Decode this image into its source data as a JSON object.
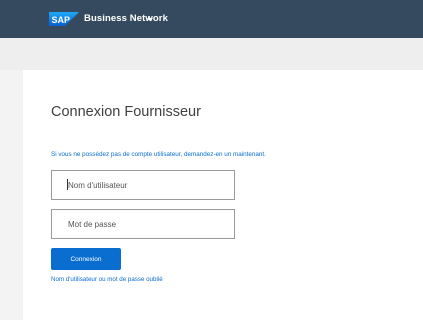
{
  "header": {
    "logo_text": "SAP",
    "brand_name": "Business Network",
    "background": "#354a5f"
  },
  "login": {
    "title": "Connexion Fournisseur",
    "info_text": "Si vous ne possédez pas de compte utilisateur, demandez-en un maintenant.",
    "username_placeholder": "Nom d'utilisateur",
    "password_placeholder": "Mot de passe",
    "submit_label": "Connexion",
    "forgot_username": "Nom d'utilisateur",
    "forgot_connector": "ou",
    "forgot_password": "mot de passe oublié",
    "accent": "#0a6ed1"
  },
  "icons": {
    "menu_caret": "chevron-down-icon"
  }
}
